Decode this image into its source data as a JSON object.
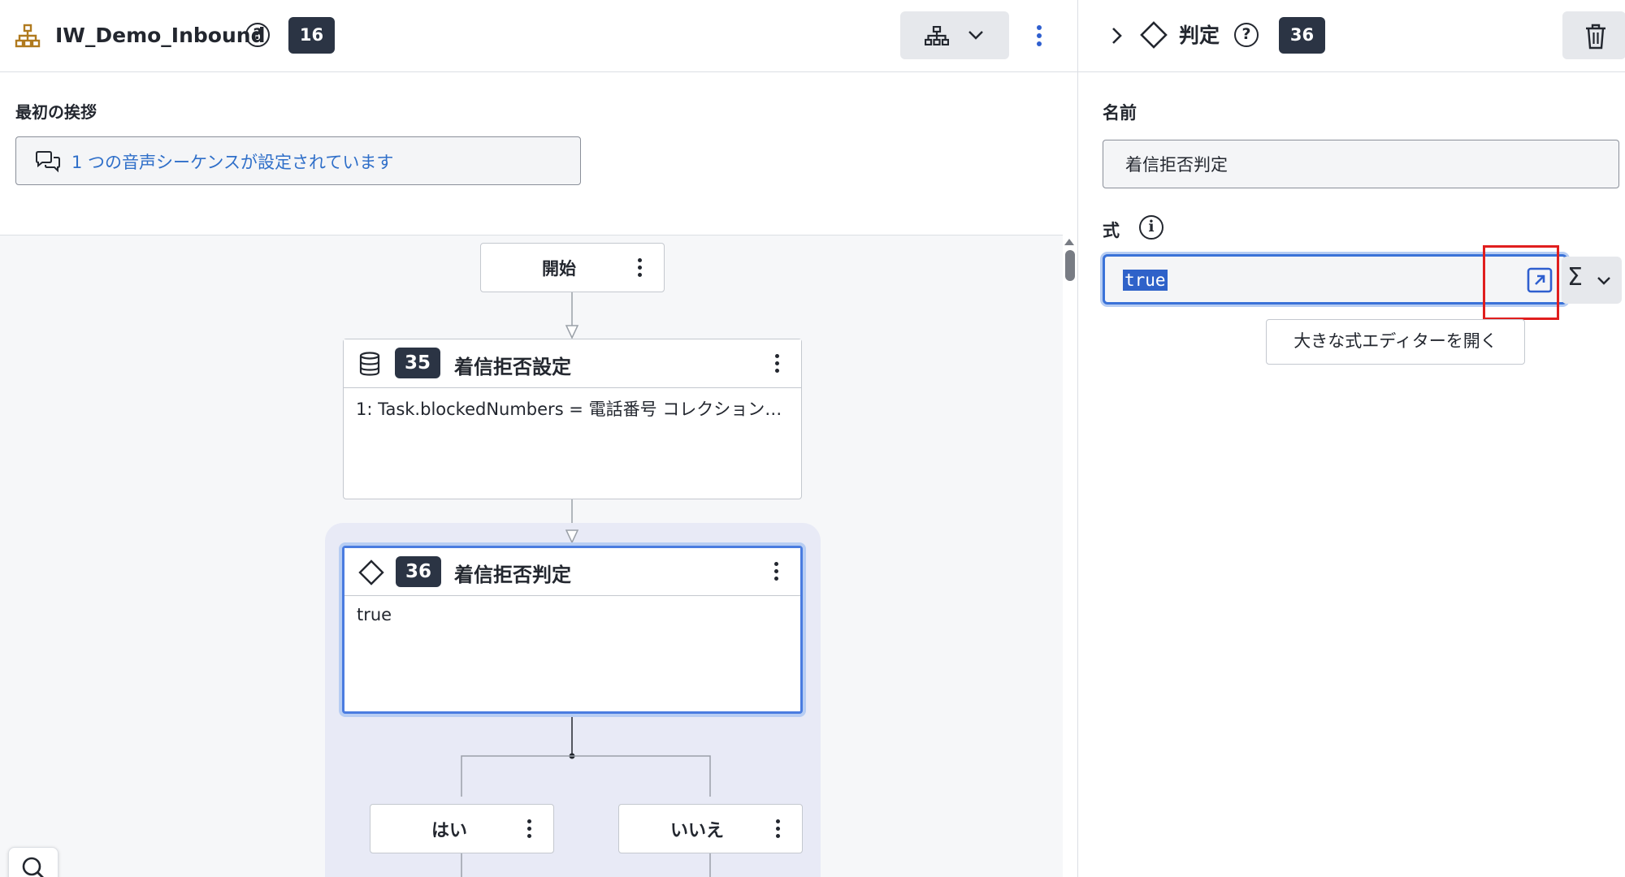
{
  "left_header": {
    "flow_name": "IW_Demo_Inbound",
    "help_glyph": "?",
    "flow_badge": "16",
    "tree_icon": "sitemap-icon",
    "more_icon": "kebab-vertical-icon"
  },
  "greeting": {
    "label": "最初の挨拶",
    "icon": "chat-bubbles-icon",
    "summary": "1 つの音声シーケンスが設定されています"
  },
  "flow_canvas": {
    "start_node": {
      "label": "開始"
    },
    "set_node": {
      "icon": "database-icon",
      "number": "35",
      "title": "着信拒否設定",
      "body": "1: Task.blockedNumbers = 電話番号 コレクション…"
    },
    "decision_node": {
      "icon": "diamond-icon",
      "number": "36",
      "title": "着信拒否判定",
      "body": "true"
    },
    "branches": [
      {
        "label": "はい"
      },
      {
        "label": "いいえ"
      }
    ],
    "search_icon": "search-icon"
  },
  "right_panel": {
    "header": {
      "collapse_icon": "chevron-right-icon",
      "type_icon": "diamond-icon",
      "title": "判定",
      "help_glyph": "?",
      "badge": "36",
      "delete_icon": "trash-icon"
    },
    "name_field": {
      "label": "名前",
      "value": "着信拒否判定"
    },
    "expression_field": {
      "label": "式",
      "info_glyph": "i",
      "value": "true",
      "open_editor_icon": "open-external-icon",
      "sigma_glyph": "Σ",
      "tooltip": "大きな式エディターを開く"
    }
  },
  "colors": {
    "badge_bg": "#2b3444",
    "accent_blue": "#3a72d8",
    "link_blue": "#2f6fc9",
    "highlight_red": "#e01e1e",
    "selected_group_bg": "#e8eaf6",
    "flow_icon_color": "#b07a1e"
  }
}
